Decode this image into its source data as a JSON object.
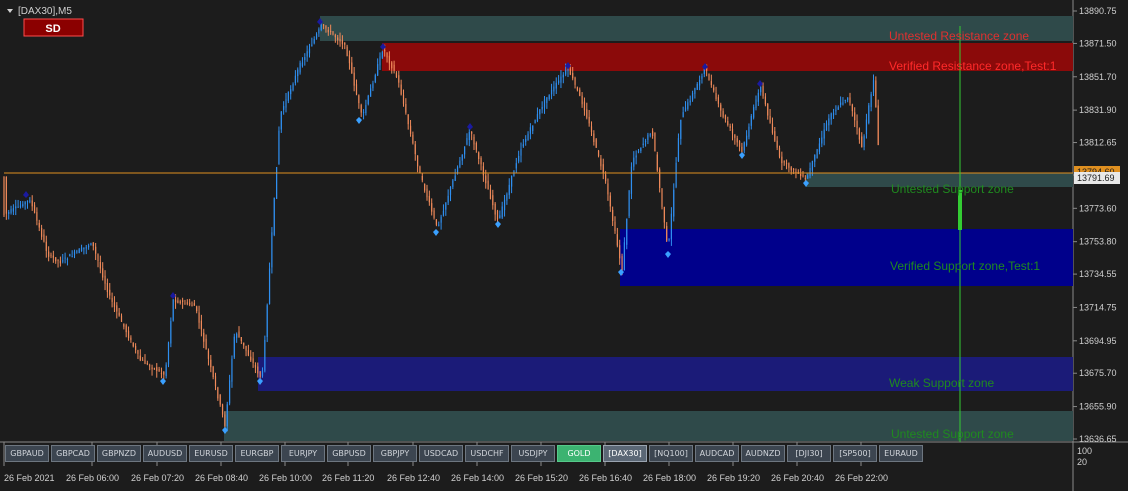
{
  "header": {
    "title": "[DAX30],M5",
    "badge": "SD"
  },
  "y_axis": {
    "ticks": [
      "13890.75",
      "13871.50",
      "13851.70",
      "13831.90",
      "13812.65",
      "13793.40",
      "13773.60",
      "13753.80",
      "13734.55",
      "13714.75",
      "13694.95",
      "13675.70",
      "13655.90",
      "13636.65"
    ],
    "current_price": "13791.69",
    "hidden_price": "13794.60",
    "volume_ticks": [
      "100",
      "20"
    ]
  },
  "x_axis": {
    "labels": [
      "26 Feb 2021",
      "26 Feb 06:00",
      "26 Feb 07:20",
      "26 Feb 08:40",
      "26 Feb 10:00",
      "26 Feb 11:20",
      "26 Feb 12:40",
      "26 Feb 14:00",
      "26 Feb 15:20",
      "26 Feb 16:40",
      "26 Feb 18:00",
      "26 Feb 19:20",
      "26 Feb 20:40",
      "26 Feb 22:00"
    ]
  },
  "zones": [
    {
      "label": "Untested Resistance zone",
      "color": "#e0302f",
      "fill": "#2f4a4a"
    },
    {
      "label": "Verified Resistance zone,Test:1",
      "color": "#ff2a2a",
      "fill": "#8b0a0a"
    },
    {
      "label": "Untested Support zone",
      "color": "#1f8a1f",
      "fill": "#2f4a4a"
    },
    {
      "label": "Verified Support zone,Test:1",
      "color": "#1f8a1f",
      "fill": "#00008b"
    },
    {
      "label": "Weak Support zone",
      "color": "#1f8a1f",
      "fill": "#1b1b78"
    },
    {
      "label": "Untested Support zone",
      "color": "#1f8a1f",
      "fill": "#2f4a4a"
    }
  ],
  "symbol_tabs": [
    "GBPAUD",
    "GBPCAD",
    "GBPNZD",
    "AUDUSD",
    "EURUSD",
    "EURGBP",
    "EURJPY",
    "GBPUSD",
    "GBPJPY",
    "USDCAD",
    "USDCHF",
    "USDJPY",
    "GOLD",
    "[DAX30]",
    "[NQ100]",
    "AUDCAD",
    "AUDNZD",
    "[DJI30]",
    "[SP500]",
    "EURAUD"
  ],
  "colors": {
    "background": "#1c1c1c",
    "bull_candle": "#2f8ff0",
    "bear_candle": "#f08a5a",
    "price_line": "#e09020",
    "cursor_line": "#33cc33",
    "gold_tab": "#3cb371"
  }
}
